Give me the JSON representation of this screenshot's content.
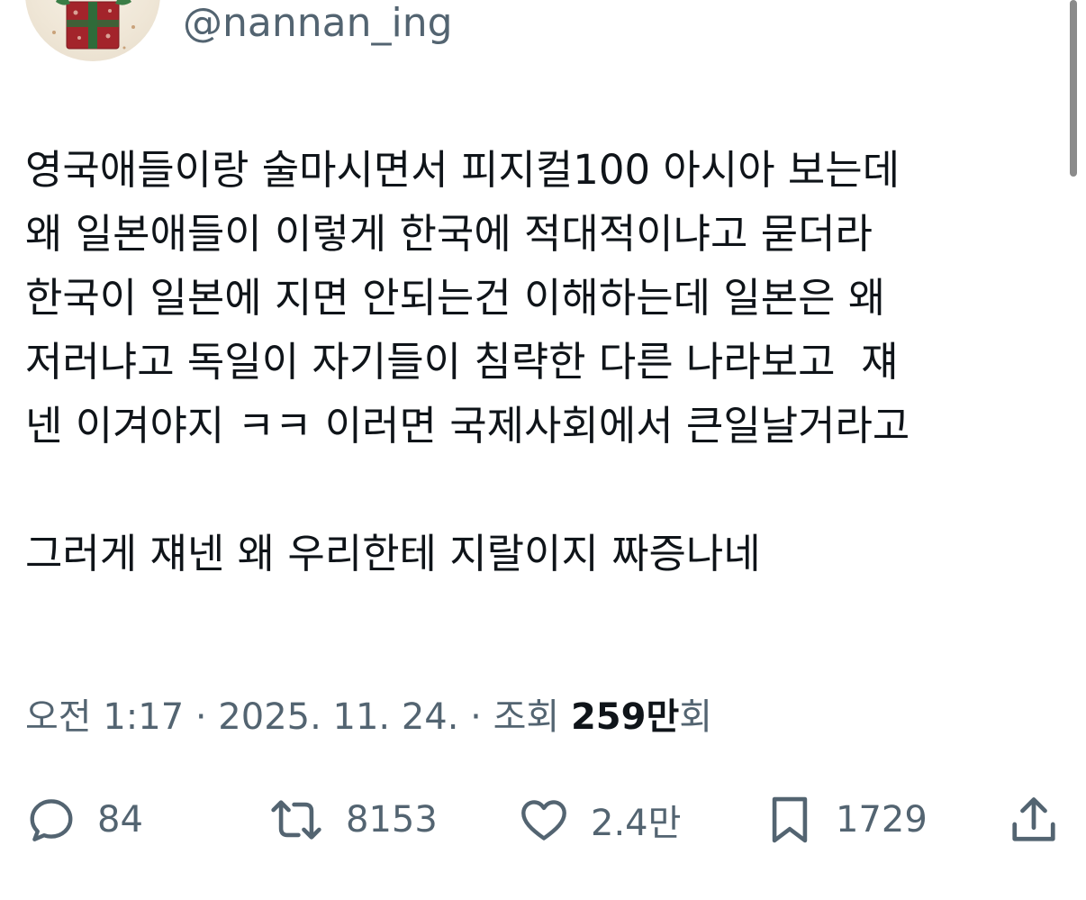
{
  "header": {
    "handle": "@nannan_ing"
  },
  "tweet": {
    "lines": [
      "영국애들이랑 술마시면서 피지컬100 아시아 보는데",
      "왜 일본애들이 이렇게 한국에 적대적이냐고 묻더라",
      "한국이 일본에 지면 안되는건 이해하는데 일본은 왜",
      "저러냐고 독일이 자기들이 침략한 다른 나라보고  쟤",
      "넨 이겨야지 ㅋㅋ 이러면 국제사회에서 큰일날거라고",
      "그러게 쟤넨 왜 우리한테 지랄이지 짜증나네"
    ]
  },
  "meta": {
    "time": "오전 1:17",
    "separator1": " · ",
    "date": "2025. 11. 24.",
    "separator2": " · ",
    "views_label": "조회 ",
    "views_count": "259만",
    "views_suffix": "회"
  },
  "actions": {
    "replies": "84",
    "reposts": "8153",
    "likes": "2.4만",
    "bookmarks": "1729"
  },
  "icons": {
    "reply": "reply-icon",
    "repost": "repost-icon",
    "like": "heart-icon",
    "bookmark": "bookmark-icon",
    "share": "share-icon"
  },
  "colors": {
    "text": "#0f1419",
    "secondary": "#536471"
  }
}
